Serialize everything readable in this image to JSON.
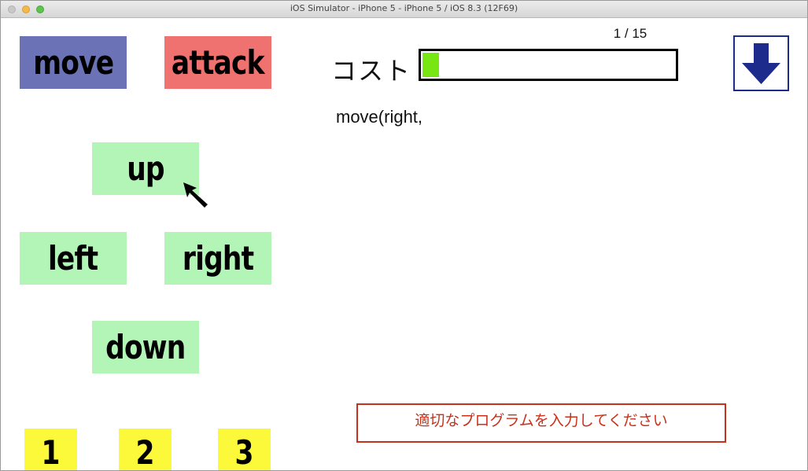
{
  "window": {
    "title": "iOS Simulator - iPhone 5 - iPhone 5 / iOS 8.3 (12F69)"
  },
  "commands": {
    "move_label": "move",
    "attack_label": "attack"
  },
  "directions": {
    "up_label": "up",
    "left_label": "left",
    "right_label": "right",
    "down_label": "down"
  },
  "numbers": [
    "1",
    "2",
    "3"
  ],
  "cost": {
    "label": "コスト",
    "counter": "1 / 15",
    "fill_fraction": 0.0667
  },
  "program": {
    "text": "move(right,"
  },
  "message": {
    "text": "適切なプログラムを入力してください"
  },
  "icons": {
    "down_button": "arrow-down-icon",
    "cursor": "mouse-pointer-icon"
  },
  "colors": {
    "move_tile": "#6b72b6",
    "attack_tile": "#ef7270",
    "direction_tile": "#b2f5b6",
    "number_tile": "#fbf93a",
    "cost_fill": "#78e612",
    "down_arrow": "#1d2c8c",
    "message": "#c8311c"
  }
}
